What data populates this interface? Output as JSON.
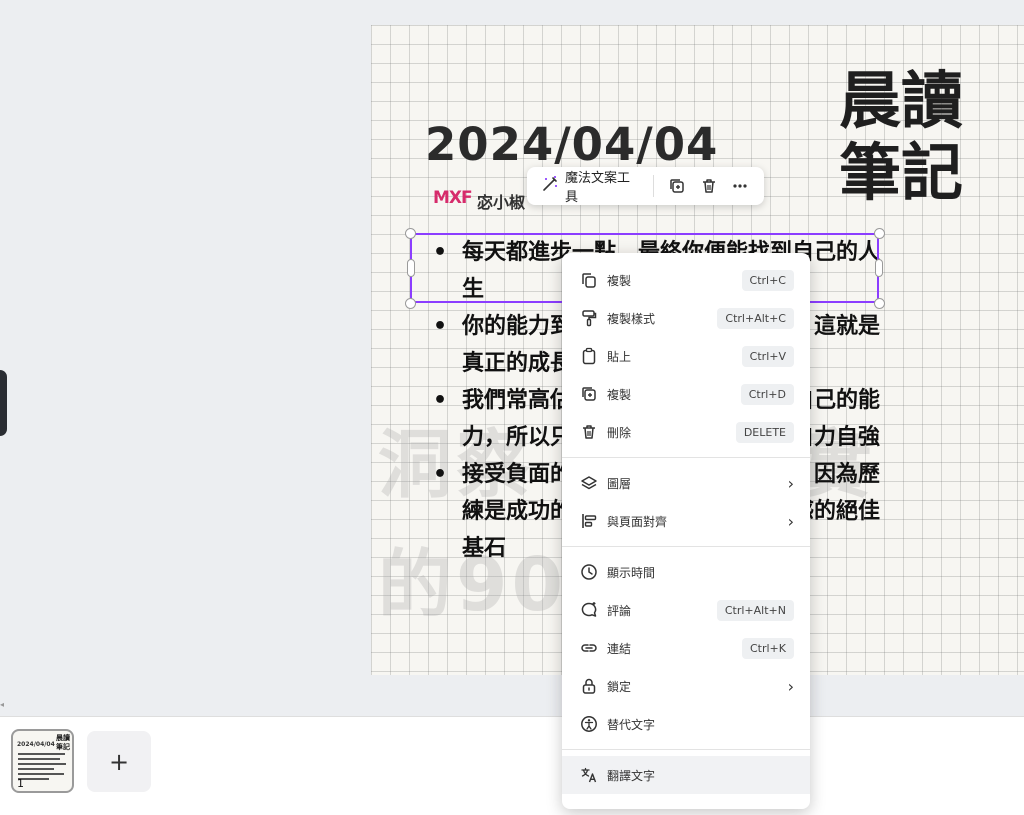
{
  "page": {
    "title_cjk": "晨讀\n筆記",
    "date": "2024/04/04",
    "logo_text": "MXF",
    "author": "宓小椒",
    "bullets": [
      "每天都進步一點，最終你便能找到自己的人生",
      "你的能力到了極限，才能突破自己，這就是真正的成長",
      "我們常高估了別人的能力，低估了自己的能力，所以只能感受到自己的軟弱，自力自強",
      "接受負面的事實，以及艱困的歷練，因為歷練是成功的基石，培養勇氣、成就感的絕佳基石"
    ],
    "watermark_line1": "洞察 洞悉現實",
    "watermark_line2": "的90 法則"
  },
  "float_toolbar": {
    "magic_label": "魔法文案工具",
    "icons": [
      "magic-wand-icon",
      "duplicate-icon",
      "trash-icon",
      "more-icon"
    ]
  },
  "context_menu": {
    "groups": [
      [
        {
          "label": "複製",
          "shortcut": "Ctrl+C",
          "icon": "copy-icon"
        },
        {
          "label": "複製樣式",
          "shortcut": "Ctrl+Alt+C",
          "icon": "paint-roller-icon"
        },
        {
          "label": "貼上",
          "shortcut": "Ctrl+V",
          "icon": "clipboard-icon"
        },
        {
          "label": "複製",
          "shortcut": "Ctrl+D",
          "icon": "duplicate-icon"
        },
        {
          "label": "刪除",
          "shortcut": "DELETE",
          "icon": "trash-icon"
        }
      ],
      [
        {
          "label": "圖層",
          "icon": "layers-icon",
          "submenu": true
        },
        {
          "label": "與頁面對齊",
          "icon": "align-icon",
          "submenu": true
        }
      ],
      [
        {
          "label": "顯示時間",
          "icon": "clock-icon"
        },
        {
          "label": "評論",
          "shortcut": "Ctrl+Alt+N",
          "icon": "comment-icon"
        },
        {
          "label": "連結",
          "shortcut": "Ctrl+K",
          "icon": "link-icon"
        },
        {
          "label": "鎖定",
          "icon": "lock-icon",
          "submenu": true
        },
        {
          "label": "替代文字",
          "icon": "accessibility-icon"
        }
      ],
      [
        {
          "label": "翻譯文字",
          "icon": "translate-icon"
        }
      ]
    ]
  },
  "bottom_bar": {
    "page_number": "1",
    "add_page_symbol": "+",
    "thumb_date": "2024/04/04",
    "thumb_title": "晨讀\n筆記"
  },
  "colors": {
    "selection": "#8b3dff",
    "logo": "#d62b6b"
  }
}
